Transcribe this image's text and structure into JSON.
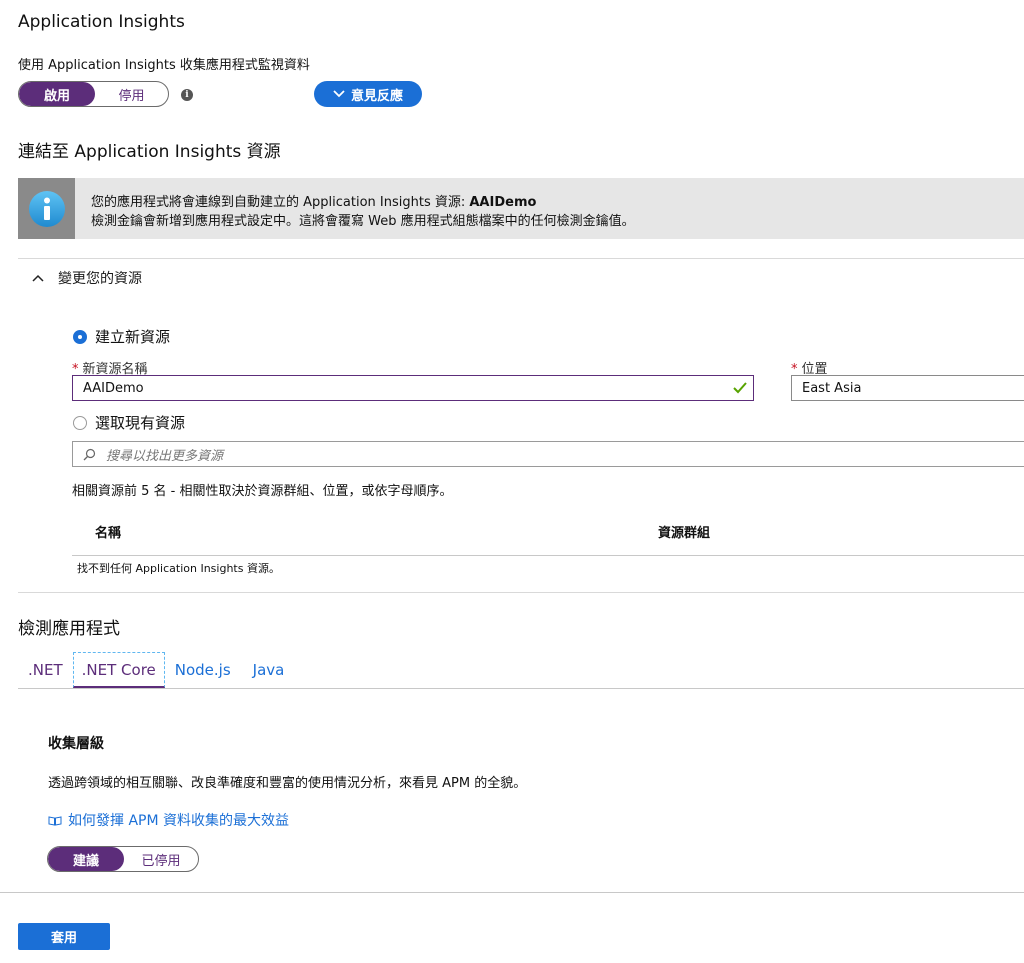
{
  "header": {
    "title": "Application Insights",
    "subtitle": "使用 Application Insights 收集應用程式監視資料"
  },
  "toggle_main": {
    "on_label": "啟用",
    "off_label": "停用"
  },
  "feedback": {
    "label": "意見反應"
  },
  "connect": {
    "title": "連結至 Application Insights 資源"
  },
  "banner": {
    "line1_prefix": "您的應用程式將會連線到自動建立的 Application Insights 資源: ",
    "line1_bold": "AAIDemo",
    "line2": "檢測金鑰會新增到應用程式設定中。這將會覆寫 Web 應用程式組態檔案中的任何檢測金鑰值。"
  },
  "change_resource": {
    "header": "變更您的資源",
    "create_new_label": "建立新資源",
    "name_label": "新資源名稱",
    "name_value": "AAIDemo",
    "location_label": "位置",
    "location_value": "East Asia",
    "select_existing_label": "選取現有資源",
    "search_placeholder": "搜尋以找出更多資源",
    "note": "相關資源前 5 名 - 相關性取決於資源群組、位置，或依字母順序。",
    "col_name": "名稱",
    "col_group": "資源群組",
    "empty": "找不到任何 Application Insights 資源。"
  },
  "instrument": {
    "title": "檢測應用程式",
    "tabs": [
      ".NET",
      ".NET Core",
      "Node.js",
      "Java"
    ]
  },
  "collection": {
    "title": "收集層級",
    "desc": "透過跨領域的相互關聯、改良準確度和豐富的使用情況分析，來看見 APM 的全貌。",
    "link": "如何發揮 APM 資料收集的最大效益",
    "on_label": "建議",
    "off_label": "已停用"
  },
  "footer": {
    "apply_label": "套用"
  },
  "colors": {
    "accent": "#1b6fd6",
    "toggle_on": "#5c2d7a",
    "error": "#c50f1f",
    "valid": "#57a300"
  }
}
